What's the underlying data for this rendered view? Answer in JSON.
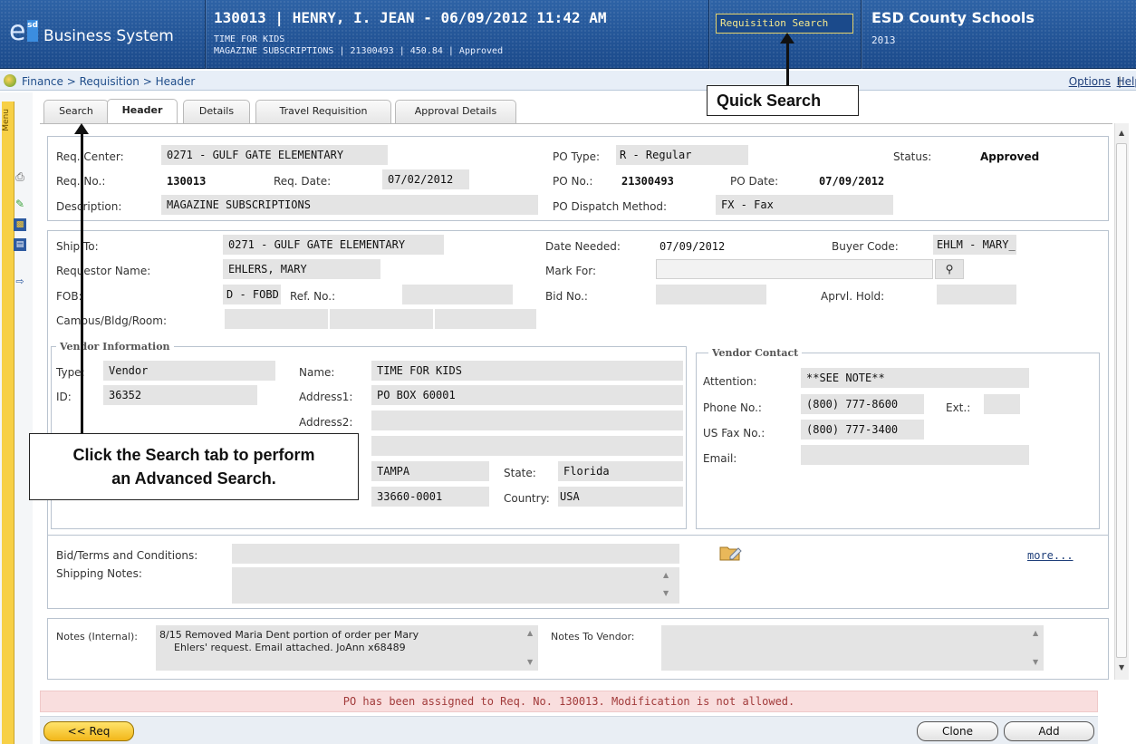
{
  "header": {
    "logo_e": "e",
    "logo_sd": "sd",
    "logo_text": "Business System",
    "title": "130013 | HENRY, I. JEAN - 06/09/2012 11:42 AM",
    "subtitle1": "TIME FOR KIDS",
    "subtitle2": "MAGAZINE SUBSCRIPTIONS | 21300493 | 450.84 | Approved",
    "quick_search_placeholder": "Requisition Search",
    "org_name": "ESD County Schools",
    "org_year": "2013"
  },
  "breadcrumb": "Finance > Requisition > Header",
  "top_links": {
    "options": "Options",
    "separator": "|",
    "help": "Help"
  },
  "rail": {
    "menu_label": "Menu",
    "icons": [
      "print-icon",
      "edit-icon",
      "report-icon",
      "form-icon",
      "export-icon"
    ]
  },
  "tabs": [
    {
      "label": "Search",
      "active": false
    },
    {
      "label": "Header",
      "active": true
    },
    {
      "label": "Details",
      "active": false
    },
    {
      "label": "Travel Requisition",
      "active": false
    },
    {
      "label": "Approval Details",
      "active": false
    }
  ],
  "summary": {
    "req_center_label": "Req. Center:",
    "req_center": "0271 - GULF GATE ELEMENTARY",
    "po_type_label": "PO Type:",
    "po_type": "R - Regular",
    "status_label": "Status:",
    "status": "Approved",
    "req_no_label": "Req. No.:",
    "req_no": "130013",
    "req_date_label": "Req. Date:",
    "req_date": "07/02/2012",
    "po_no_label": "PO No.:",
    "po_no": "21300493",
    "po_date_label": "PO Date:",
    "po_date": "07/09/2012",
    "description_label": "Description:",
    "description": "MAGAZINE SUBSCRIPTIONS",
    "dispatch_label": "PO Dispatch Method:",
    "dispatch": "FX - Fax"
  },
  "shipping": {
    "ship_to_label": "Ship To:",
    "ship_to": "0271 - GULF GATE ELEMENTARY",
    "date_needed_label": "Date Needed:",
    "date_needed": "07/09/2012",
    "buyer_code_label": "Buyer Code:",
    "buyer_code": "EHLM - MARY_",
    "requestor_label": "Requestor Name:",
    "requestor": "EHLERS, MARY",
    "mark_for_label": "Mark For:",
    "mark_for": "",
    "fob_label": "FOB:",
    "fob": "D - FOBD Dé",
    "ref_no_label": "Ref. No.:",
    "ref_no": "",
    "bid_no_label": "Bid No.:",
    "bid_no": "",
    "aprvl_hold_label": "Aprvl. Hold:",
    "aprvl_hold": "",
    "campus_label": "Campus/Bldg/Room:"
  },
  "vendor": {
    "legend": "Vendor Information",
    "type_label": "Type:",
    "type": "Vendor",
    "id_label": "ID:",
    "id": "36352",
    "name_label": "Name:",
    "name": "TIME FOR KIDS",
    "address1_label": "Address1:",
    "address1": "PO BOX 60001",
    "address2_label": "Address2:",
    "address2": "",
    "city": "TAMPA",
    "state_label": "State:",
    "state": "Florida",
    "zip": "33660-0001",
    "country_label": "Country:",
    "country": "USA"
  },
  "contact": {
    "legend": "Vendor Contact",
    "attention_label": "Attention:",
    "attention": "**SEE NOTE**",
    "phone_label": "Phone No.:",
    "phone": "(800) 777-8600",
    "ext_label": "Ext.:",
    "ext": "",
    "fax_label": "US Fax No.:",
    "fax": "(800) 777-3400",
    "email_label": "Email:",
    "email": ""
  },
  "terms": {
    "bid_terms_label": "Bid/Terms and Conditions:",
    "shipping_notes_label": "Shipping Notes:",
    "more_link": "more..."
  },
  "notes": {
    "internal_label": "Notes (Internal):",
    "internal_line1": "8/15 Removed Maria Dent portion of order per Mary",
    "internal_line2": "Ehlers' request.  Email attached.  JoAnn x68489",
    "vendor_label": "Notes To Vendor:"
  },
  "message": "PO has been assigned to Req. No. 130013. Modification is not allowed.",
  "buttons": {
    "back_req": "<< Req",
    "clone": "Clone",
    "add": "Add"
  },
  "callouts": {
    "quick_search": "Quick Search",
    "search_tab_line1": "Click the Search tab to perform",
    "search_tab_line2": "an Advanced Search."
  }
}
